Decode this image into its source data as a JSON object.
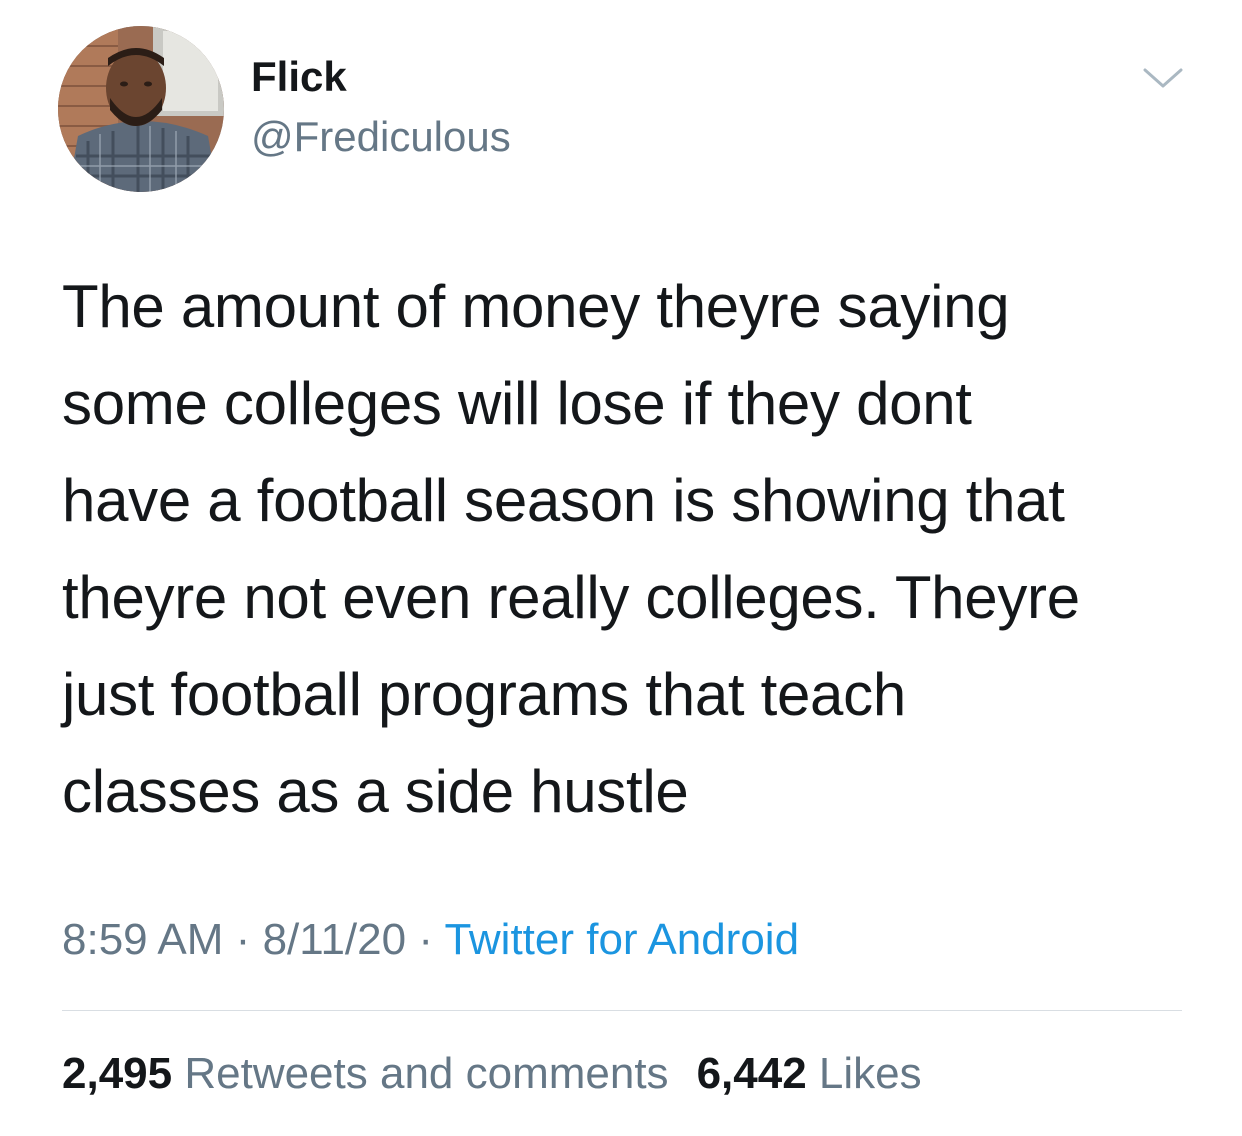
{
  "user": {
    "display_name": "Flick",
    "handle": "@Frediculous"
  },
  "tweet": {
    "lines": [
      "The amount of money theyre saying",
      "some colleges will lose if they dont",
      "have a football season is showing that",
      "theyre not even really colleges. Theyre",
      "just football programs that teach",
      "classes as a side hustle"
    ],
    "time": "8:59 AM",
    "separator": "·",
    "date": "8/11/20",
    "source": "Twitter for Android"
  },
  "stats": {
    "retweets_count": "2,495",
    "retweets_label": "Retweets and comments",
    "likes_count": "6,442",
    "likes_label": "Likes"
  },
  "icons": {
    "more": "chevron-down-icon"
  },
  "colors": {
    "text": "#14171a",
    "secondary": "#657786",
    "link": "#1b95e0",
    "divider": "#d9dee3"
  }
}
